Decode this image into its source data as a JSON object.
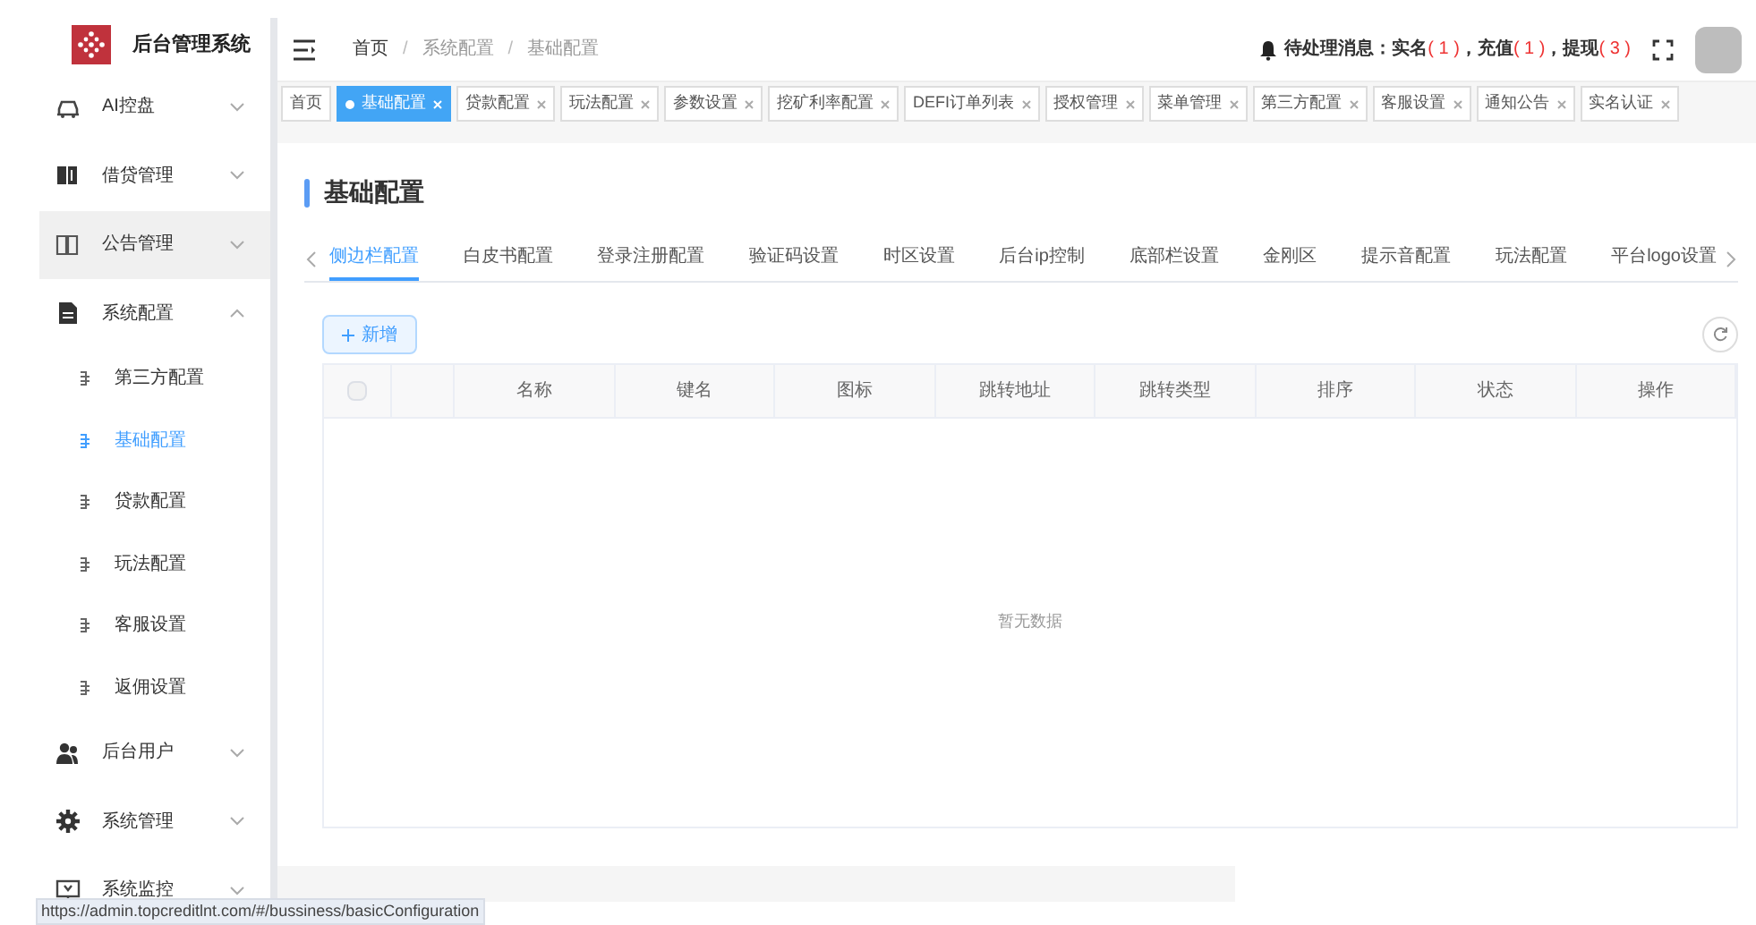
{
  "brand": {
    "title": "后台管理系统"
  },
  "sidebar": {
    "items": [
      {
        "label": "AI控盘",
        "expanded": false,
        "hovered": false
      },
      {
        "label": "借贷管理",
        "expanded": false,
        "hovered": false
      },
      {
        "label": "公告管理",
        "expanded": false,
        "hovered": true
      },
      {
        "label": "系统配置",
        "expanded": true,
        "hovered": false,
        "children": [
          {
            "label": "第三方配置",
            "selected": false
          },
          {
            "label": "基础配置",
            "selected": true
          },
          {
            "label": "贷款配置",
            "selected": false
          },
          {
            "label": "玩法配置",
            "selected": false
          },
          {
            "label": "客服设置",
            "selected": false
          },
          {
            "label": "返佣设置",
            "selected": false
          }
        ]
      },
      {
        "label": "后台用户",
        "expanded": false,
        "hovered": false
      },
      {
        "label": "系统管理",
        "expanded": false,
        "hovered": false
      },
      {
        "label": "系统监控",
        "expanded": false,
        "hovered": false
      }
    ]
  },
  "breadcrumb": [
    {
      "kind": "link",
      "text": "首页"
    },
    {
      "kind": "separator",
      "text": "/"
    },
    {
      "kind": "link",
      "text": "系统配置"
    },
    {
      "kind": "separator",
      "text": "/"
    },
    {
      "kind": "link",
      "text": "基础配置"
    }
  ],
  "notice": {
    "label": "待处理消息：",
    "items": [
      {
        "name": "实名",
        "count": "( 1 )"
      },
      {
        "name": "，充值",
        "count": "( 1 )"
      },
      {
        "name": "，提现",
        "count": "( 3 )"
      }
    ]
  },
  "tags": [
    {
      "label": "首页",
      "selected": false,
      "closable": false
    },
    {
      "label": "基础配置",
      "selected": true,
      "closable": true
    },
    {
      "label": "贷款配置",
      "selected": false,
      "closable": true
    },
    {
      "label": "玩法配置",
      "selected": false,
      "closable": true
    },
    {
      "label": "参数设置",
      "selected": false,
      "closable": true
    },
    {
      "label": "挖矿利率配置",
      "selected": false,
      "closable": true
    },
    {
      "label": "DEFI订单列表",
      "selected": false,
      "closable": true
    },
    {
      "label": "授权管理",
      "selected": false,
      "closable": true
    },
    {
      "label": "菜单管理",
      "selected": false,
      "closable": true
    },
    {
      "label": "第三方配置",
      "selected": false,
      "closable": true
    },
    {
      "label": "客服设置",
      "selected": false,
      "closable": true
    },
    {
      "label": "通知公告",
      "selected": false,
      "closable": true
    },
    {
      "label": "实名认证",
      "selected": false,
      "closable": true
    }
  ],
  "page_title": "基础配置",
  "tabs": [
    {
      "label": "侧边栏配置",
      "selected": true
    },
    {
      "label": "白皮书配置",
      "selected": false
    },
    {
      "label": "登录注册配置",
      "selected": false
    },
    {
      "label": "验证码设置",
      "selected": false
    },
    {
      "label": "时区设置",
      "selected": false
    },
    {
      "label": "后台ip控制",
      "selected": false
    },
    {
      "label": "底部栏设置",
      "selected": false
    },
    {
      "label": "金刚区",
      "selected": false
    },
    {
      "label": "提示音配置",
      "selected": false
    },
    {
      "label": "玩法配置",
      "selected": false
    },
    {
      "label": "平台logo设置",
      "selected": false
    }
  ],
  "toolbar": {
    "add_button": "新增"
  },
  "table": {
    "select_all_checked": false,
    "columns": [
      "名称",
      "键名",
      "图标",
      "跳转地址",
      "跳转类型",
      "排序",
      "状态",
      "操作"
    ],
    "empty_text": "暂无数据"
  },
  "status_url": "https://admin.topcreditlnt.com/#/bussiness/basicConfiguration"
}
